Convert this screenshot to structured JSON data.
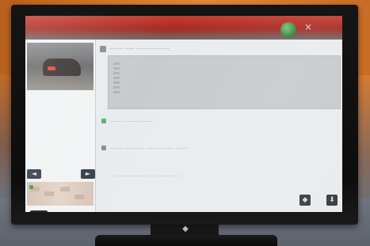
{
  "scene": {
    "subject": "computer-monitor-on-stand",
    "background": "orange-and-gray-blurred-backdrop"
  },
  "screen": {
    "top_bar": {
      "has_green_ball": true,
      "close_glyph": "×"
    },
    "left_panel": {
      "nav_prev_glyph": "◄",
      "nav_next_glyph": "►",
      "footer_text": "........ ...."
    },
    "content": {
      "title_text": "........ ...... ........ ...........",
      "green_text": "........ .. ....... ........",
      "row2_text": "......... ........... ......... ....... .......",
      "row3_text": "..... .. ........ ......... ..... ..... .......... ......"
    },
    "toolbar": {
      "tool1_glyph": "◆",
      "tool2_glyph": "⬇"
    }
  }
}
